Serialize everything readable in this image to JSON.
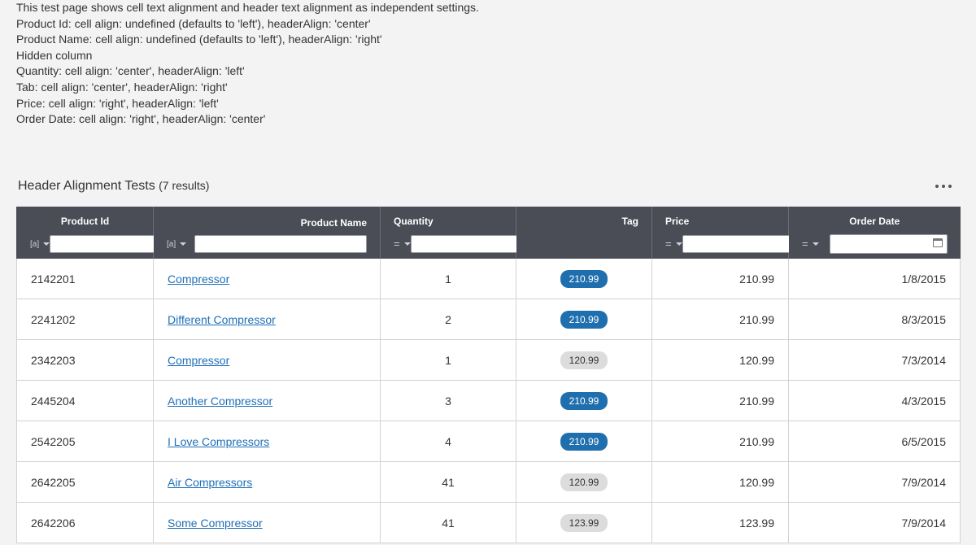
{
  "notes": [
    "This test page shows cell text alignment and header text alignment as independent settings.",
    "Product Id: cell align: undefined (defaults to 'left'), headerAlign: 'center'",
    "Product Name: cell align: undefined (defaults to 'left'), headerAlign: 'right'",
    "Hidden column",
    "Quantity: cell align: 'center', headerAlign: 'left'",
    "Tab: cell align: 'center', headerAlign: 'right'",
    "Price: cell align: 'right', headerAlign: 'left'",
    "Order Date: cell align: 'right', headerAlign: 'center'"
  ],
  "grid": {
    "title": "Header Alignment Tests",
    "count": "(7 results)",
    "more_icon": "more-horizontal-icon",
    "columns": [
      {
        "label": "Product Id",
        "filter_op_icon": "string-filter-icon"
      },
      {
        "label": "Product Name",
        "filter_op_icon": "string-filter-icon"
      },
      {
        "label": "Quantity",
        "filter_op_icon": "equals-filter-icon"
      },
      {
        "label": "Tag"
      },
      {
        "label": "Price",
        "filter_op_icon": "equals-filter-icon"
      },
      {
        "label": "Order Date",
        "filter_op_icon": "equals-filter-icon",
        "date_icon": "calendar-icon"
      }
    ],
    "filter_op_glyphs": {
      "string": "[a]",
      "equals": "="
    },
    "tag_colors": {
      "high": "#1f6fae",
      "low": "#dcdcdc"
    },
    "rows": [
      {
        "id": "2142201",
        "name": "Compressor",
        "qty": "1",
        "tag": "210.99",
        "tag_style": "high",
        "price": "210.99",
        "date": "1/8/2015"
      },
      {
        "id": "2241202",
        "name": "Different Compressor",
        "qty": "2",
        "tag": "210.99",
        "tag_style": "high",
        "price": "210.99",
        "date": "8/3/2015"
      },
      {
        "id": "2342203",
        "name": "Compressor",
        "qty": "1",
        "tag": "120.99",
        "tag_style": "low",
        "price": "120.99",
        "date": "7/3/2014"
      },
      {
        "id": "2445204",
        "name": "Another Compressor",
        "qty": "3",
        "tag": "210.99",
        "tag_style": "high",
        "price": "210.99",
        "date": "4/3/2015"
      },
      {
        "id": "2542205",
        "name": "I Love Compressors",
        "qty": "4",
        "tag": "210.99",
        "tag_style": "high",
        "price": "210.99",
        "date": "6/5/2015"
      },
      {
        "id": "2642205",
        "name": "Air Compressors",
        "qty": "41",
        "tag": "120.99",
        "tag_style": "low",
        "price": "120.99",
        "date": "7/9/2014"
      },
      {
        "id": "2642206",
        "name": "Some Compressor",
        "qty": "41",
        "tag": "123.99",
        "tag_style": "low",
        "price": "123.99",
        "date": "7/9/2014"
      }
    ]
  }
}
